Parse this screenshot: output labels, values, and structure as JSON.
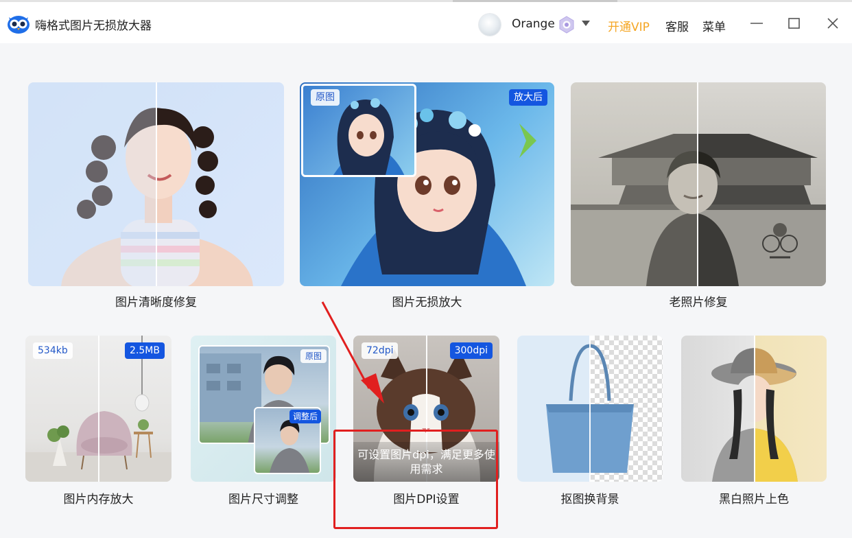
{
  "app": {
    "title": "嗨格式图片无损放大器"
  },
  "header": {
    "username": "Orange",
    "vip_label": "开通VIP",
    "service_label": "客服",
    "menu_label": "菜单"
  },
  "features_top": [
    {
      "label": "图片清晰度修复"
    },
    {
      "label": "图片无损放大",
      "tag_left": "原图",
      "tag_right": "放大后"
    },
    {
      "label": "老照片修复"
    }
  ],
  "features_bottom": [
    {
      "label": "图片内存放大",
      "tag_left": "534kb",
      "tag_right": "2.5MB"
    },
    {
      "label": "图片尺寸调整",
      "tag_left": "原图",
      "tag_right": "调整后"
    },
    {
      "label": "图片DPI设置",
      "tag_left": "72dpi",
      "tag_right": "300dpi",
      "hover_text": "可设置图片dpi，满足更多使用需求"
    },
    {
      "label": "抠图换背景"
    },
    {
      "label": "黑白照片上色"
    }
  ],
  "colors": {
    "accent_blue": "#1456e0",
    "vip_orange": "#f5a623",
    "highlight_red": "#e11f1f"
  },
  "icons": {
    "logo": "owl-logo-icon",
    "user_badge": "vip-badge-icon",
    "dropdown": "chevron-down-icon",
    "minimize": "minimize-icon",
    "maximize": "maximize-icon",
    "close": "close-icon",
    "annotation": "red-arrow-icon"
  }
}
